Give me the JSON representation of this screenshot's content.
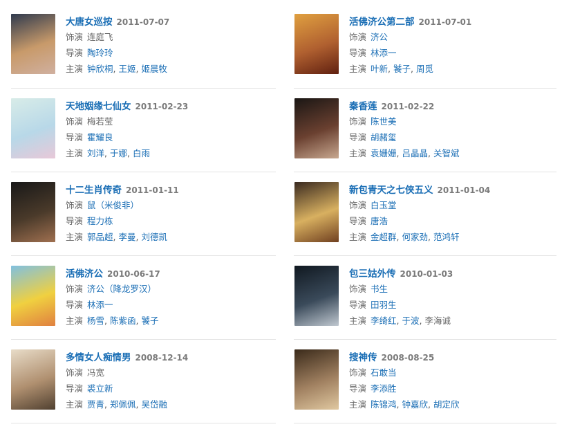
{
  "labels": {
    "role": "饰演",
    "director": "导演",
    "cast": "主演"
  },
  "items": [
    {
      "title": "大唐女巡按",
      "date": "2011-07-07",
      "role": "连庭飞",
      "role_link": false,
      "director": "陶玲玲",
      "cast": [
        "钟欣桐",
        "王姬",
        "姬晨牧"
      ],
      "poster": [
        "#2f3a4e",
        "#c89a6a",
        "#d0b0a0"
      ]
    },
    {
      "title": "活佛济公第二部",
      "date": "2011-07-01",
      "role": "济公",
      "role_link": true,
      "director": "林添一",
      "cast": [
        "叶新",
        "饕子",
        "周觅"
      ],
      "poster": [
        "#e0a040",
        "#b06030",
        "#602010"
      ]
    },
    {
      "title": "天地姻缘七仙女",
      "date": "2011-02-23",
      "role": "梅若莹",
      "role_link": false,
      "director": "霍耀良",
      "cast": [
        "刘洋",
        "于娜",
        "白雨"
      ],
      "poster": [
        "#d8ece8",
        "#b8d8e8",
        "#e8c8d8"
      ]
    },
    {
      "title": "秦香莲",
      "date": "2011-02-22",
      "role": "陈世美",
      "role_link": true,
      "director": "胡赭玺",
      "cast": [
        "袁姗姗",
        "吕晶晶",
        "关智斌"
      ],
      "poster": [
        "#1a1614",
        "#6a4030",
        "#c8a890"
      ]
    },
    {
      "title": "十二生肖传奇",
      "date": "2011-01-11",
      "role": "鼠（米俊非）",
      "role_link": true,
      "director": "程力栋",
      "cast": [
        "郭品超",
        "李曼",
        "刘德凯"
      ],
      "poster": [
        "#181818",
        "#4a3a2a",
        "#a07050"
      ]
    },
    {
      "title": "新包青天之七侠五义",
      "date": "2011-01-04",
      "role": "白玉堂",
      "role_link": true,
      "director": "唐浩",
      "cast": [
        "金超群",
        "何家劲",
        "范鸿轩"
      ],
      "poster": [
        "#3a2a20",
        "#d8b060",
        "#704020"
      ]
    },
    {
      "title": "活佛济公",
      "date": "2010-06-17",
      "role": "济公（降龙罗汉）",
      "role_link": true,
      "director": "林添一",
      "cast": [
        "杨雪",
        "陈紫函",
        "饕子"
      ],
      "poster": [
        "#80c0e0",
        "#f0d040",
        "#e08040"
      ]
    },
    {
      "title": "包三姑外传",
      "date": "2010-01-03",
      "role": "书生",
      "role_link": true,
      "director": "田羽生",
      "cast": [
        "李绮红",
        "于波",
        "李海诚"
      ],
      "cast_link": [
        true,
        true,
        false
      ],
      "poster": [
        "#101820",
        "#3a4a5a",
        "#c0c8d0"
      ]
    },
    {
      "title": "多情女人痴情男",
      "date": "2008-12-14",
      "role": "冯宽",
      "role_link": false,
      "director": "裘立新",
      "cast": [
        "贾青",
        "郑佩佩",
        "吴岱融"
      ],
      "poster": [
        "#e8dcc8",
        "#b09070",
        "#504030"
      ]
    },
    {
      "title": "搜神传",
      "date": "2008-08-25",
      "role": "石敢当",
      "role_link": true,
      "director": "李添胜",
      "cast": [
        "陈锦鸿",
        "钟嘉欣",
        "胡定欣"
      ],
      "poster": [
        "#3a2a1a",
        "#a08060",
        "#e0c8a0"
      ]
    }
  ]
}
